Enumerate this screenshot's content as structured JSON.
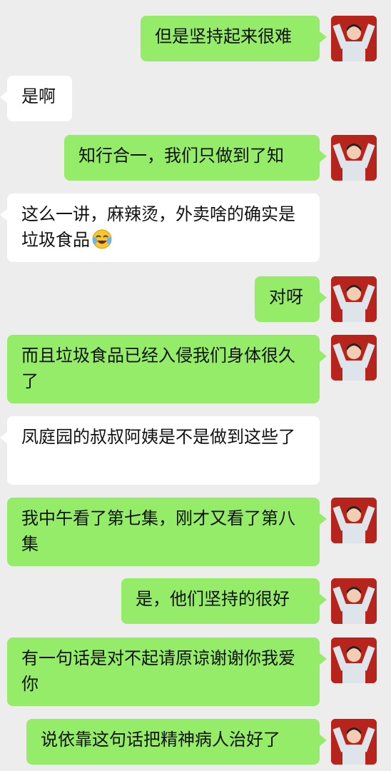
{
  "messages": [
    {
      "side": "me",
      "text": "但是坚持起来很难",
      "avatar": "user-avatar"
    },
    {
      "side": "other",
      "text": "是啊"
    },
    {
      "side": "me",
      "text": "知行合一，我们只做到了知",
      "avatar": "user-avatar"
    },
    {
      "side": "other",
      "text": "这么一讲，麻辣烫，外卖啥的确实是垃圾食品",
      "emoji": "laugh-cry-emoji"
    },
    {
      "side": "me",
      "text": "对呀",
      "avatar": "user-avatar"
    },
    {
      "side": "me",
      "text": "而且垃圾食品已经入侵我们身体很久了",
      "avatar": "user-avatar"
    },
    {
      "side": "other",
      "text": "凤庭园的叔叔阿姨是不是做到这些了"
    },
    {
      "side": "me",
      "text": "我中午看了第七集，刚才又看了第八集",
      "avatar": "user-avatar"
    },
    {
      "side": "me",
      "text": "是，他们坚持的很好",
      "avatar": "user-avatar"
    },
    {
      "side": "me",
      "text": "有一句话是对不起请原谅谢谢你我爱你",
      "avatar": "user-avatar"
    },
    {
      "side": "me",
      "text": "说依靠这句话把精神病人治好了",
      "avatar": "user-avatar"
    }
  ],
  "colors": {
    "background": "#ededed",
    "my_bubble": "#95ec69",
    "other_bubble": "#ffffff",
    "avatar_bg": "#b7241c"
  }
}
